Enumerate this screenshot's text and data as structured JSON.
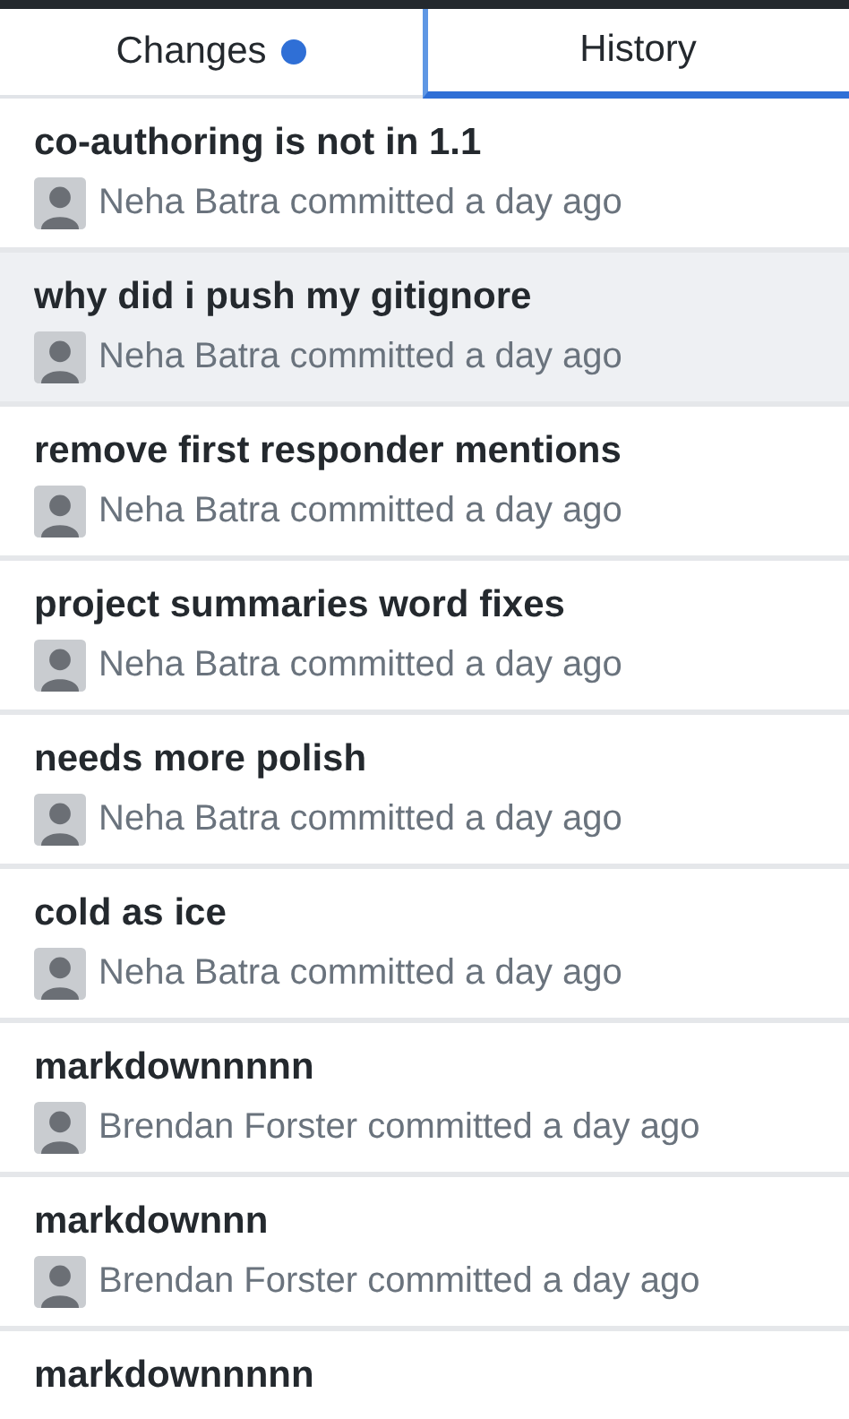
{
  "tabs": [
    {
      "label": "Changes",
      "selected": false,
      "has_changes": true
    },
    {
      "label": "History",
      "selected": true,
      "has_changes": false
    }
  ],
  "commits": [
    {
      "summary": "co-authoring is not in 1.1",
      "author": "Neha Batra committed a day ago",
      "selected": false
    },
    {
      "summary": "why did i push my gitignore",
      "author": "Neha Batra committed a day ago",
      "selected": true
    },
    {
      "summary": "remove first responder mentions",
      "author": "Neha Batra committed a day ago",
      "selected": false
    },
    {
      "summary": "project summaries word fixes",
      "author": "Neha Batra committed a day ago",
      "selected": false
    },
    {
      "summary": "needs more polish",
      "author": "Neha Batra committed a day ago",
      "selected": false
    },
    {
      "summary": "cold as ice",
      "author": "Neha Batra committed a day ago",
      "selected": false
    },
    {
      "summary": "markdownnnnn",
      "author": "Brendan Forster committed a day ago",
      "selected": false
    },
    {
      "summary": "markdownnn",
      "author": "Brendan Forster committed a day ago",
      "selected": false
    },
    {
      "summary": "markdownnnnn",
      "selected": false
    }
  ]
}
